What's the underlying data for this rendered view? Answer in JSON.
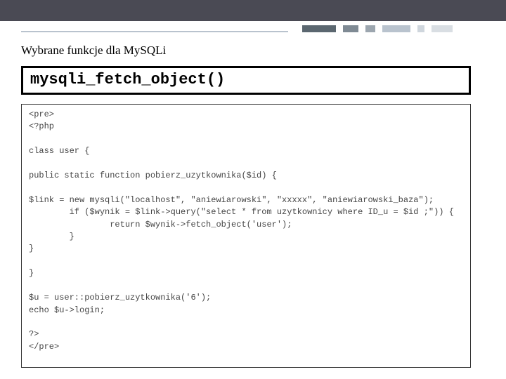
{
  "section_title": "Wybrane funkcje dla MySQLi",
  "function_name": "mysqli_fetch_object()",
  "code": {
    "l01": "<pre>",
    "l02": "<?php",
    "l03": "",
    "l04": "class user {",
    "l05": "",
    "l06": "public static function pobierz_uzytkownika($id) {",
    "l07": "",
    "l08": "$link = new mysqli(\"localhost\", \"aniewiarowski\", \"xxxxx\", \"aniewiarowski_baza\");",
    "l09": "        if ($wynik = $link->query(\"select * from uzytkownicy where ID_u = $id ;\")) {",
    "l10": "                return $wynik->fetch_object('user');",
    "l11": "        }",
    "l12": "}",
    "l13": "",
    "l14": "}",
    "l15": "",
    "l16": "$u = user::pobierz_uzytkownika('6');",
    "l17": "echo $u->login;",
    "l18": "",
    "l19": "?>",
    "l20": "</pre>"
  }
}
